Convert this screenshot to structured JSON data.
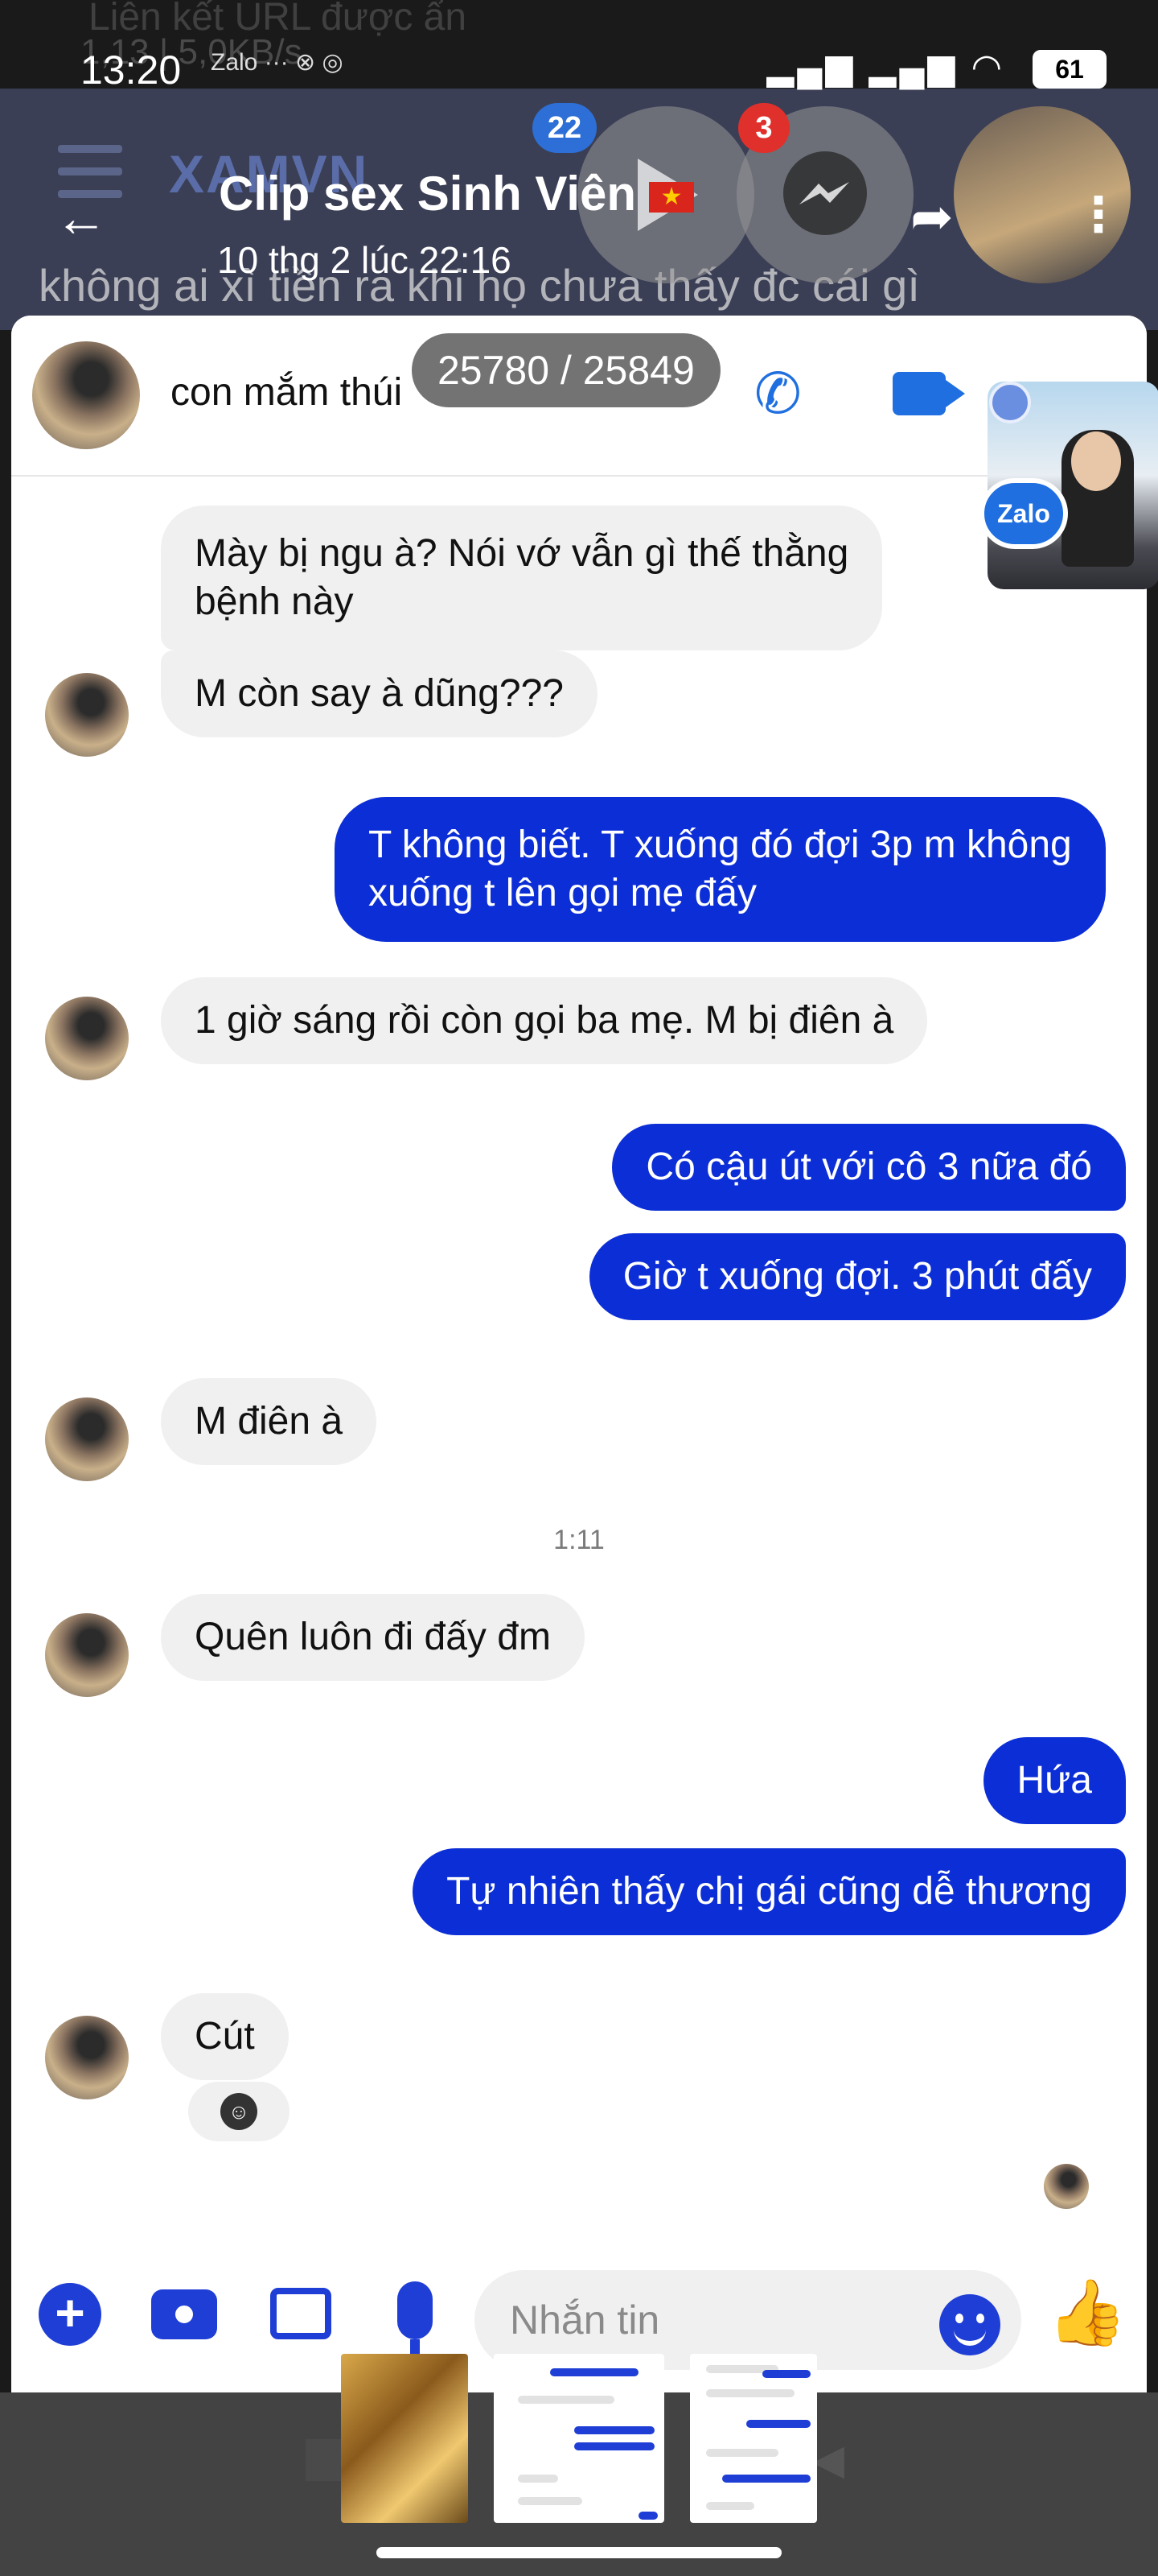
{
  "status_bar": {
    "time": "13:20",
    "left_icons": "Zalo ··· ⊗ ◎",
    "battery": "61"
  },
  "background_page": {
    "top_text": "Liên kết URL được ẩn",
    "speed_text": "1,13 | 5,0KB/s",
    "site_logo": "XAMVN",
    "body_text": "không ai xì tiền ra khi họ chưa thấy đc cái gì"
  },
  "floating_bubbles": {
    "play_badge": "22",
    "messenger_badge": "3"
  },
  "post_header": {
    "back_icon": "arrow-left-icon",
    "title": "Clip sex Sinh Viên",
    "flag": "★",
    "date": "10 thg 2 lúc 22:16",
    "share_icon": "share-icon",
    "more_icon": "more-vertical-icon"
  },
  "chat": {
    "contact_name": "con mắm thúi",
    "image_counter": "25780 / 25849",
    "zalo_label": "Zalo",
    "messages": [
      {
        "side": "in",
        "line1": "Mày bị ngu à? Nói vớ vẫn gì thế thằng",
        "line2": "bệnh này"
      },
      {
        "side": "in",
        "line1": "M còn say à dũng???"
      },
      {
        "side": "out",
        "line1": "T không biết. T xuống đó đợi 3p m không",
        "line2": "xuống t lên gọi mẹ đấy"
      },
      {
        "side": "in",
        "line1": "1 giờ sáng rồi còn gọi ba mẹ. M bị điên à"
      },
      {
        "side": "out",
        "line1": "Có cậu út với cô 3 nữa đó"
      },
      {
        "side": "out",
        "line1": "Giờ t xuống đợi. 3 phút đấy"
      },
      {
        "side": "in",
        "line1": "M điên à"
      },
      {
        "side": "in",
        "line1": "Quên luôn đi đấy đm"
      },
      {
        "side": "out",
        "line1": "Hứa"
      },
      {
        "side": "out",
        "line1": "Tự nhiên thấy chị gái cũng dễ thương"
      },
      {
        "side": "in",
        "line1": "Cút"
      }
    ],
    "time_separator": "1:11",
    "composer_placeholder": "Nhắn tin"
  },
  "colors": {
    "outgoing_bubble": "#0c2ed6",
    "incoming_bubble": "#f0f0f0",
    "accent": "#1f6fe0"
  }
}
